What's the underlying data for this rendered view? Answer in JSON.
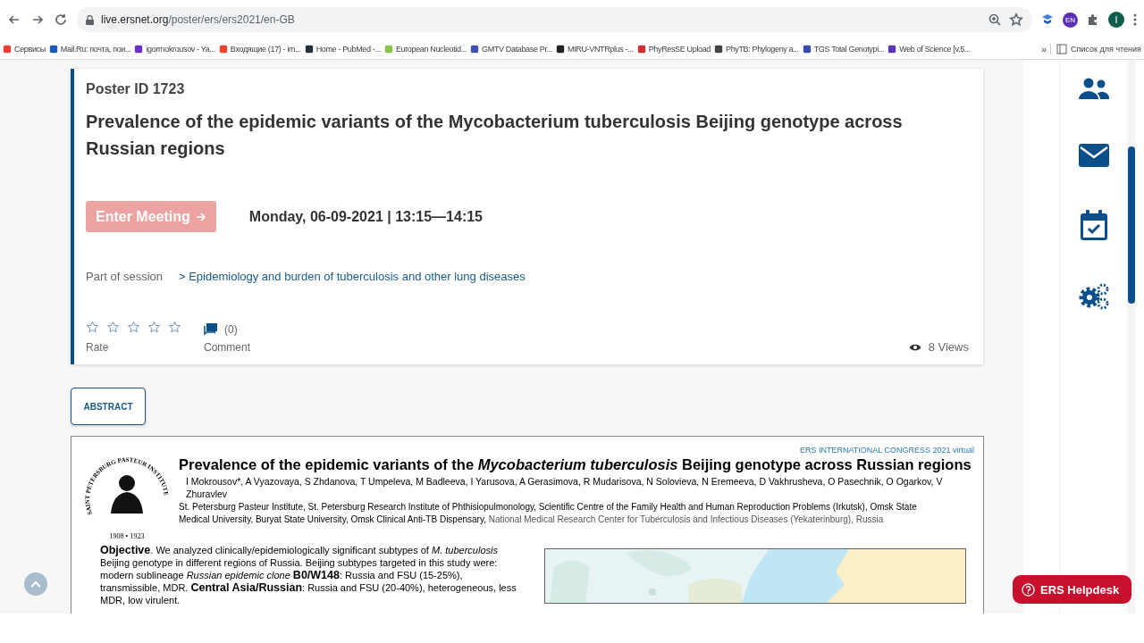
{
  "browser": {
    "url_host": "live.ersnet.org",
    "url_path": "/poster/ers/ers2021/en-GB",
    "extension_badge": "EN",
    "profile_initial": "I",
    "bookmarks": [
      {
        "label": "Сервисы",
        "color": "#e94235"
      },
      {
        "label": "Mail.Ru: почта, пои...",
        "color": "#1e5bb8"
      },
      {
        "label": "igormokrousov - Ya...",
        "color": "#6b2fd1"
      },
      {
        "label": "Входящие (17) - im...",
        "color": "#ea4335"
      },
      {
        "label": "Home - PubMed -...",
        "color": "#20303c"
      },
      {
        "label": "European Nucleotid...",
        "color": "#8bc34a"
      },
      {
        "label": "GMTV Database Pr...",
        "color": "#3f51b5"
      },
      {
        "label": "MIRU-VNTRplus -...",
        "color": "#222222"
      },
      {
        "label": "PhyResSE Upload",
        "color": "#d32f2f"
      },
      {
        "label": "PhyTB: Phylogeny a...",
        "color": "#444444"
      },
      {
        "label": "TGS Total Genotypi...",
        "color": "#3949ab"
      },
      {
        "label": "Web of Science [v.5...",
        "color": "#5e35b1"
      }
    ],
    "more": "»",
    "reading_list": "Список для чтения"
  },
  "poster_card": {
    "poster_id": "Poster ID 1723",
    "title": "Prevalence of the epidemic variants of the Mycobacterium tuberculosis Beijing genotype across Russian regions",
    "enter_button": {
      "label": "Enter Meeting",
      "disabled": true
    },
    "date": "Monday, 06-09-2021 | 13:15—14:15",
    "session_label": "Part of session",
    "session_link": "> Epidemiology and burden of tuberculosis and other lung diseases",
    "stars": 0,
    "rate_label": "Rate",
    "comment_count": "(0)",
    "comment_label": "Comment",
    "views": "8 Views"
  },
  "abstract_button": "ABSTRACT",
  "poster": {
    "congress": "ERS INTERNATIONAL CONGRESS 2021 virtual",
    "logo_ring": "SAINT PETERSBURG PASTEUR INSTITUTE",
    "logo_years": "1908 • 1923",
    "title": "Prevalence of the epidemic variants of the *Mycobacterium tuberculosis* Beijing genotype across Russian regions",
    "authors": "I Mokrousov*, A Vyazovaya, S Zhdanova, T Umpeleva, M Badleeva, I Yarusova, A Gerasimova, R Mudarisova, N Solovieva, N Eremeeva, D Vakhrusheva, O Pasechnik, O Ogarkov, V Zhuravlev",
    "affiliations": "St. Petersburg Pasteur Institute, St. Petersburg Research Institute of Phthisiopulmonology, Scientific Centre of the Family Health and Human Reproduction Problems (Irkutsk), Omsk State Medical University, Buryat State University, Omsk Clinical Anti-TB Dispensary,",
    "affiliations_extra": "National Medical Research Center for Tuberculosis and Infectious Diseases (Yekaterinburg), Russia",
    "objective": "**Objective**. We analyzed clinically/epidemiologically significant subtypes of *M. tuberculosis* Beijing genotype in different regions of Russia. Beijing subtypes targeted in this study were: modern sublineage *Russian epidemic clone* **B0/W148**: Russia and FSU (15-25%), transmissible, MDR. **Central Asia/Russian**: Russia and FSU (20-40%), heterogeneous, less MDR, low virulent."
  },
  "helpdesk": "ERS Helpdesk"
}
